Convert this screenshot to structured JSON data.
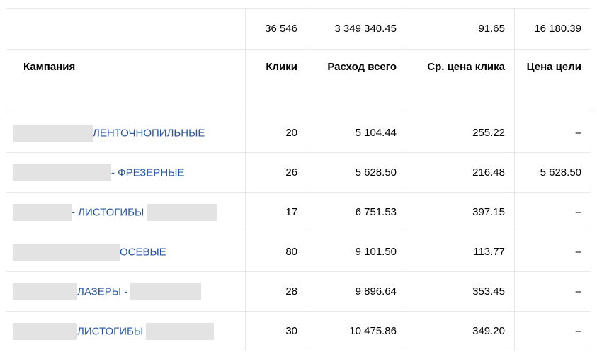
{
  "totals": {
    "clicks": "36 546",
    "cost": "3 349 340.45",
    "cpc": "91.65",
    "goal_price": "16 180.39"
  },
  "headers": {
    "campaign": "Кампания",
    "clicks": "Клики",
    "cost": "Расход всего",
    "cpc": "Ср. цена клика",
    "goal_price": "Цена цели"
  },
  "rows": [
    {
      "campaign": "ЛЕНТОЧНОПИЛЬНЫЕ",
      "clicks": "20",
      "cost": "5 104.44",
      "cpc": "255.22",
      "goal_price": "–"
    },
    {
      "campaign": "- ФРЕЗЕРНЫЕ",
      "clicks": "26",
      "cost": "5 628.50",
      "cpc": "216.48",
      "goal_price": "5 628.50"
    },
    {
      "campaign": "- ЛИСТОГИБЫ",
      "clicks": "17",
      "cost": "6 751.53",
      "cpc": "397.15",
      "goal_price": "–"
    },
    {
      "campaign": "ОСЕВЫЕ",
      "clicks": "80",
      "cost": "9 101.50",
      "cpc": "113.77",
      "goal_price": "–"
    },
    {
      "campaign": "ЛАЗЕРЫ -",
      "clicks": "28",
      "cost": "9 896.64",
      "cpc": "353.45",
      "goal_price": "–"
    },
    {
      "campaign": "ЛИСТОГИБЫ",
      "clicks": "30",
      "cost": "10 475.86",
      "cpc": "349.20",
      "goal_price": "–"
    }
  ]
}
